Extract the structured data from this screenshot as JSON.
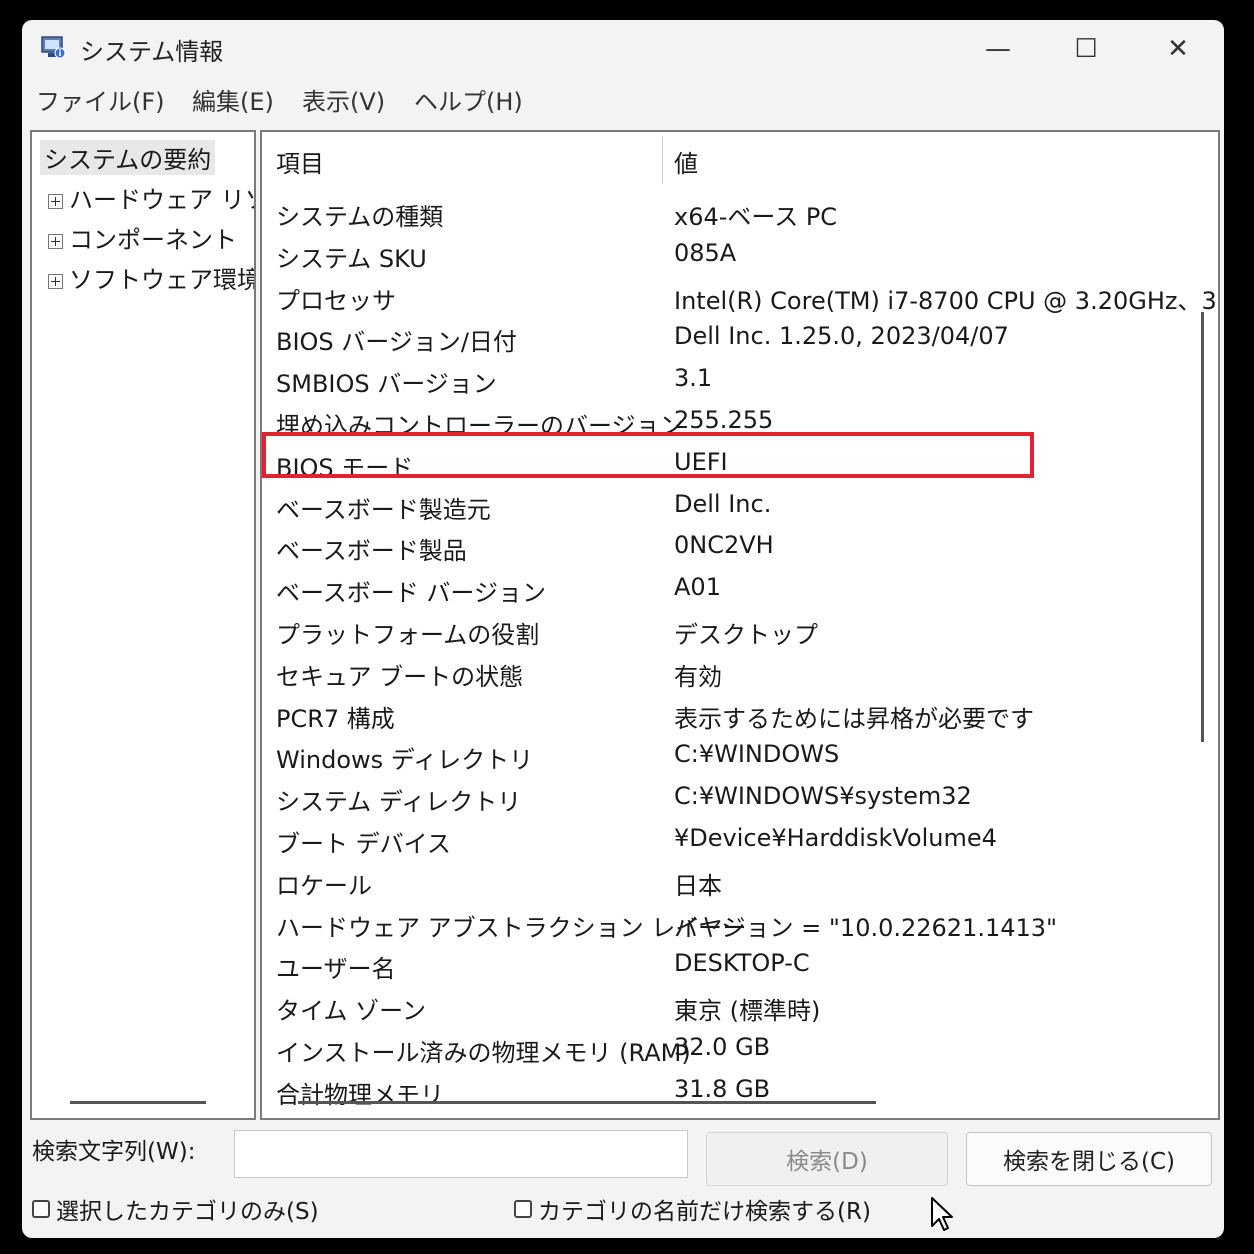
{
  "window": {
    "title": "システム情報"
  },
  "titlebar": {
    "minimize_glyph": "—",
    "maximize_glyph": "☐",
    "close_glyph": "✕"
  },
  "menu": {
    "items": [
      "ファイル(F)",
      "編集(E)",
      "表示(V)",
      "ヘルプ(H)"
    ]
  },
  "tree": {
    "root": "システムの要約",
    "items": [
      "ハードウェア リソース",
      "コンポーネント",
      "ソフトウェア環境"
    ]
  },
  "list": {
    "headers": {
      "item": "項目",
      "value": "値"
    },
    "rows": [
      {
        "name": "システムの種類",
        "value": "x64-ベース PC"
      },
      {
        "name": "システム SKU",
        "value": "085A"
      },
      {
        "name": "プロセッサ",
        "value": "Intel(R) Core(TM) i7-8700 CPU @ 3.20GHz、3"
      },
      {
        "name": "BIOS バージョン/日付",
        "value": "Dell Inc. 1.25.0, 2023/04/07"
      },
      {
        "name": "SMBIOS バージョン",
        "value": "3.1"
      },
      {
        "name": "埋め込みコントローラーのバージョン",
        "value": "255.255"
      },
      {
        "name": "BIOS モード",
        "value": "UEFI"
      },
      {
        "name": "ベースボード製造元",
        "value": "Dell Inc."
      },
      {
        "name": "ベースボード製品",
        "value": "0NC2VH"
      },
      {
        "name": "ベースボード バージョン",
        "value": "A01"
      },
      {
        "name": "プラットフォームの役割",
        "value": "デスクトップ"
      },
      {
        "name": "セキュア ブートの状態",
        "value": "有効"
      },
      {
        "name": "PCR7 構成",
        "value": "表示するためには昇格が必要です"
      },
      {
        "name": "Windows ディレクトリ",
        "value": "C:¥WINDOWS"
      },
      {
        "name": "システム ディレクトリ",
        "value": "C:¥WINDOWS¥system32"
      },
      {
        "name": "ブート デバイス",
        "value": "¥Device¥HarddiskVolume4"
      },
      {
        "name": "ロケール",
        "value": "日本"
      },
      {
        "name": "ハードウェア アブストラクション レイヤー",
        "value": "バージョン = \"10.0.22621.1413\""
      },
      {
        "name": "ユーザー名",
        "value": "DESKTOP-C"
      },
      {
        "name": "タイム ゾーン",
        "value": "東京 (標準時)"
      },
      {
        "name": "インストール済みの物理メモリ (RAM)",
        "value": "32.0 GB"
      },
      {
        "name": "合計物理メモリ",
        "value": "31.8 GB"
      }
    ]
  },
  "search": {
    "label": "検索文字列(W):",
    "value": "",
    "search_button": "検索(D)",
    "close_button": "検索を閉じる(C)",
    "selected_only": "選択したカテゴリのみ(S)",
    "names_only": "カテゴリの名前だけ検索する(R)"
  },
  "colors": {
    "highlight": "#e1232f",
    "window_bg": "#f3f3f3"
  }
}
